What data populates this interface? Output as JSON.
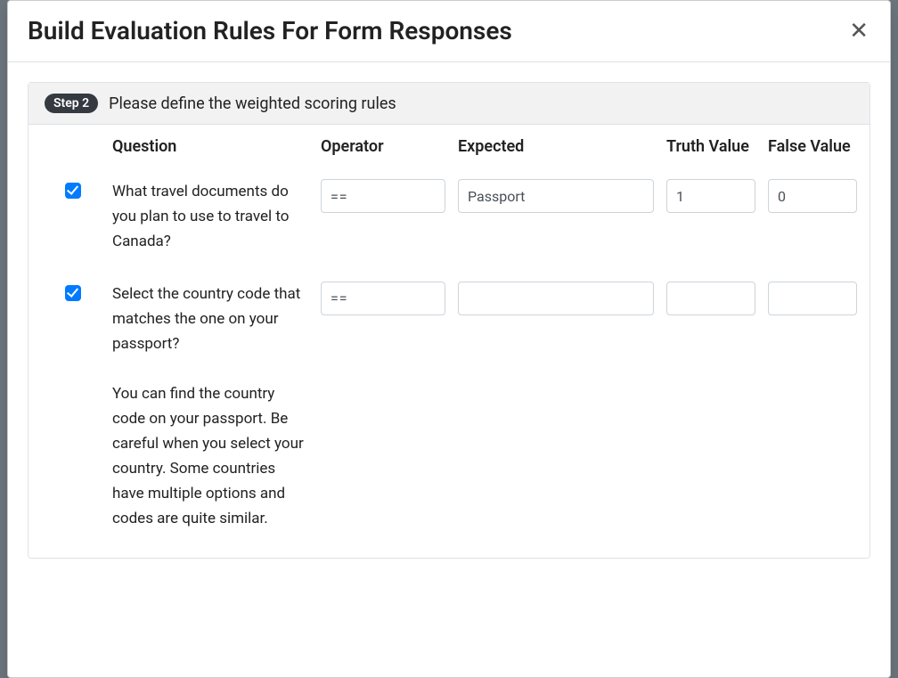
{
  "modal": {
    "title": "Build Evaluation Rules For Form Responses"
  },
  "panel": {
    "step_label": "Step 2",
    "instruction": "Please define the weighted scoring rules"
  },
  "columns": {
    "check": "",
    "question": "Question",
    "operator": "Operator",
    "expected": "Expected",
    "truth": "Truth Value",
    "falsev": "False Value"
  },
  "rows": [
    {
      "checked": true,
      "question": "What travel documents do you plan to use to travel to Canada?",
      "help": "",
      "operator": "==",
      "expected": "Passport",
      "truth": "1",
      "falsev": "0"
    },
    {
      "checked": true,
      "question": "Select the country code that matches the one on your passport?",
      "help": "You can find the country code on your passport. Be careful when you select your country. Some countries have multiple options and codes are quite similar.",
      "operator": "==",
      "expected": "",
      "truth": "",
      "falsev": ""
    }
  ]
}
